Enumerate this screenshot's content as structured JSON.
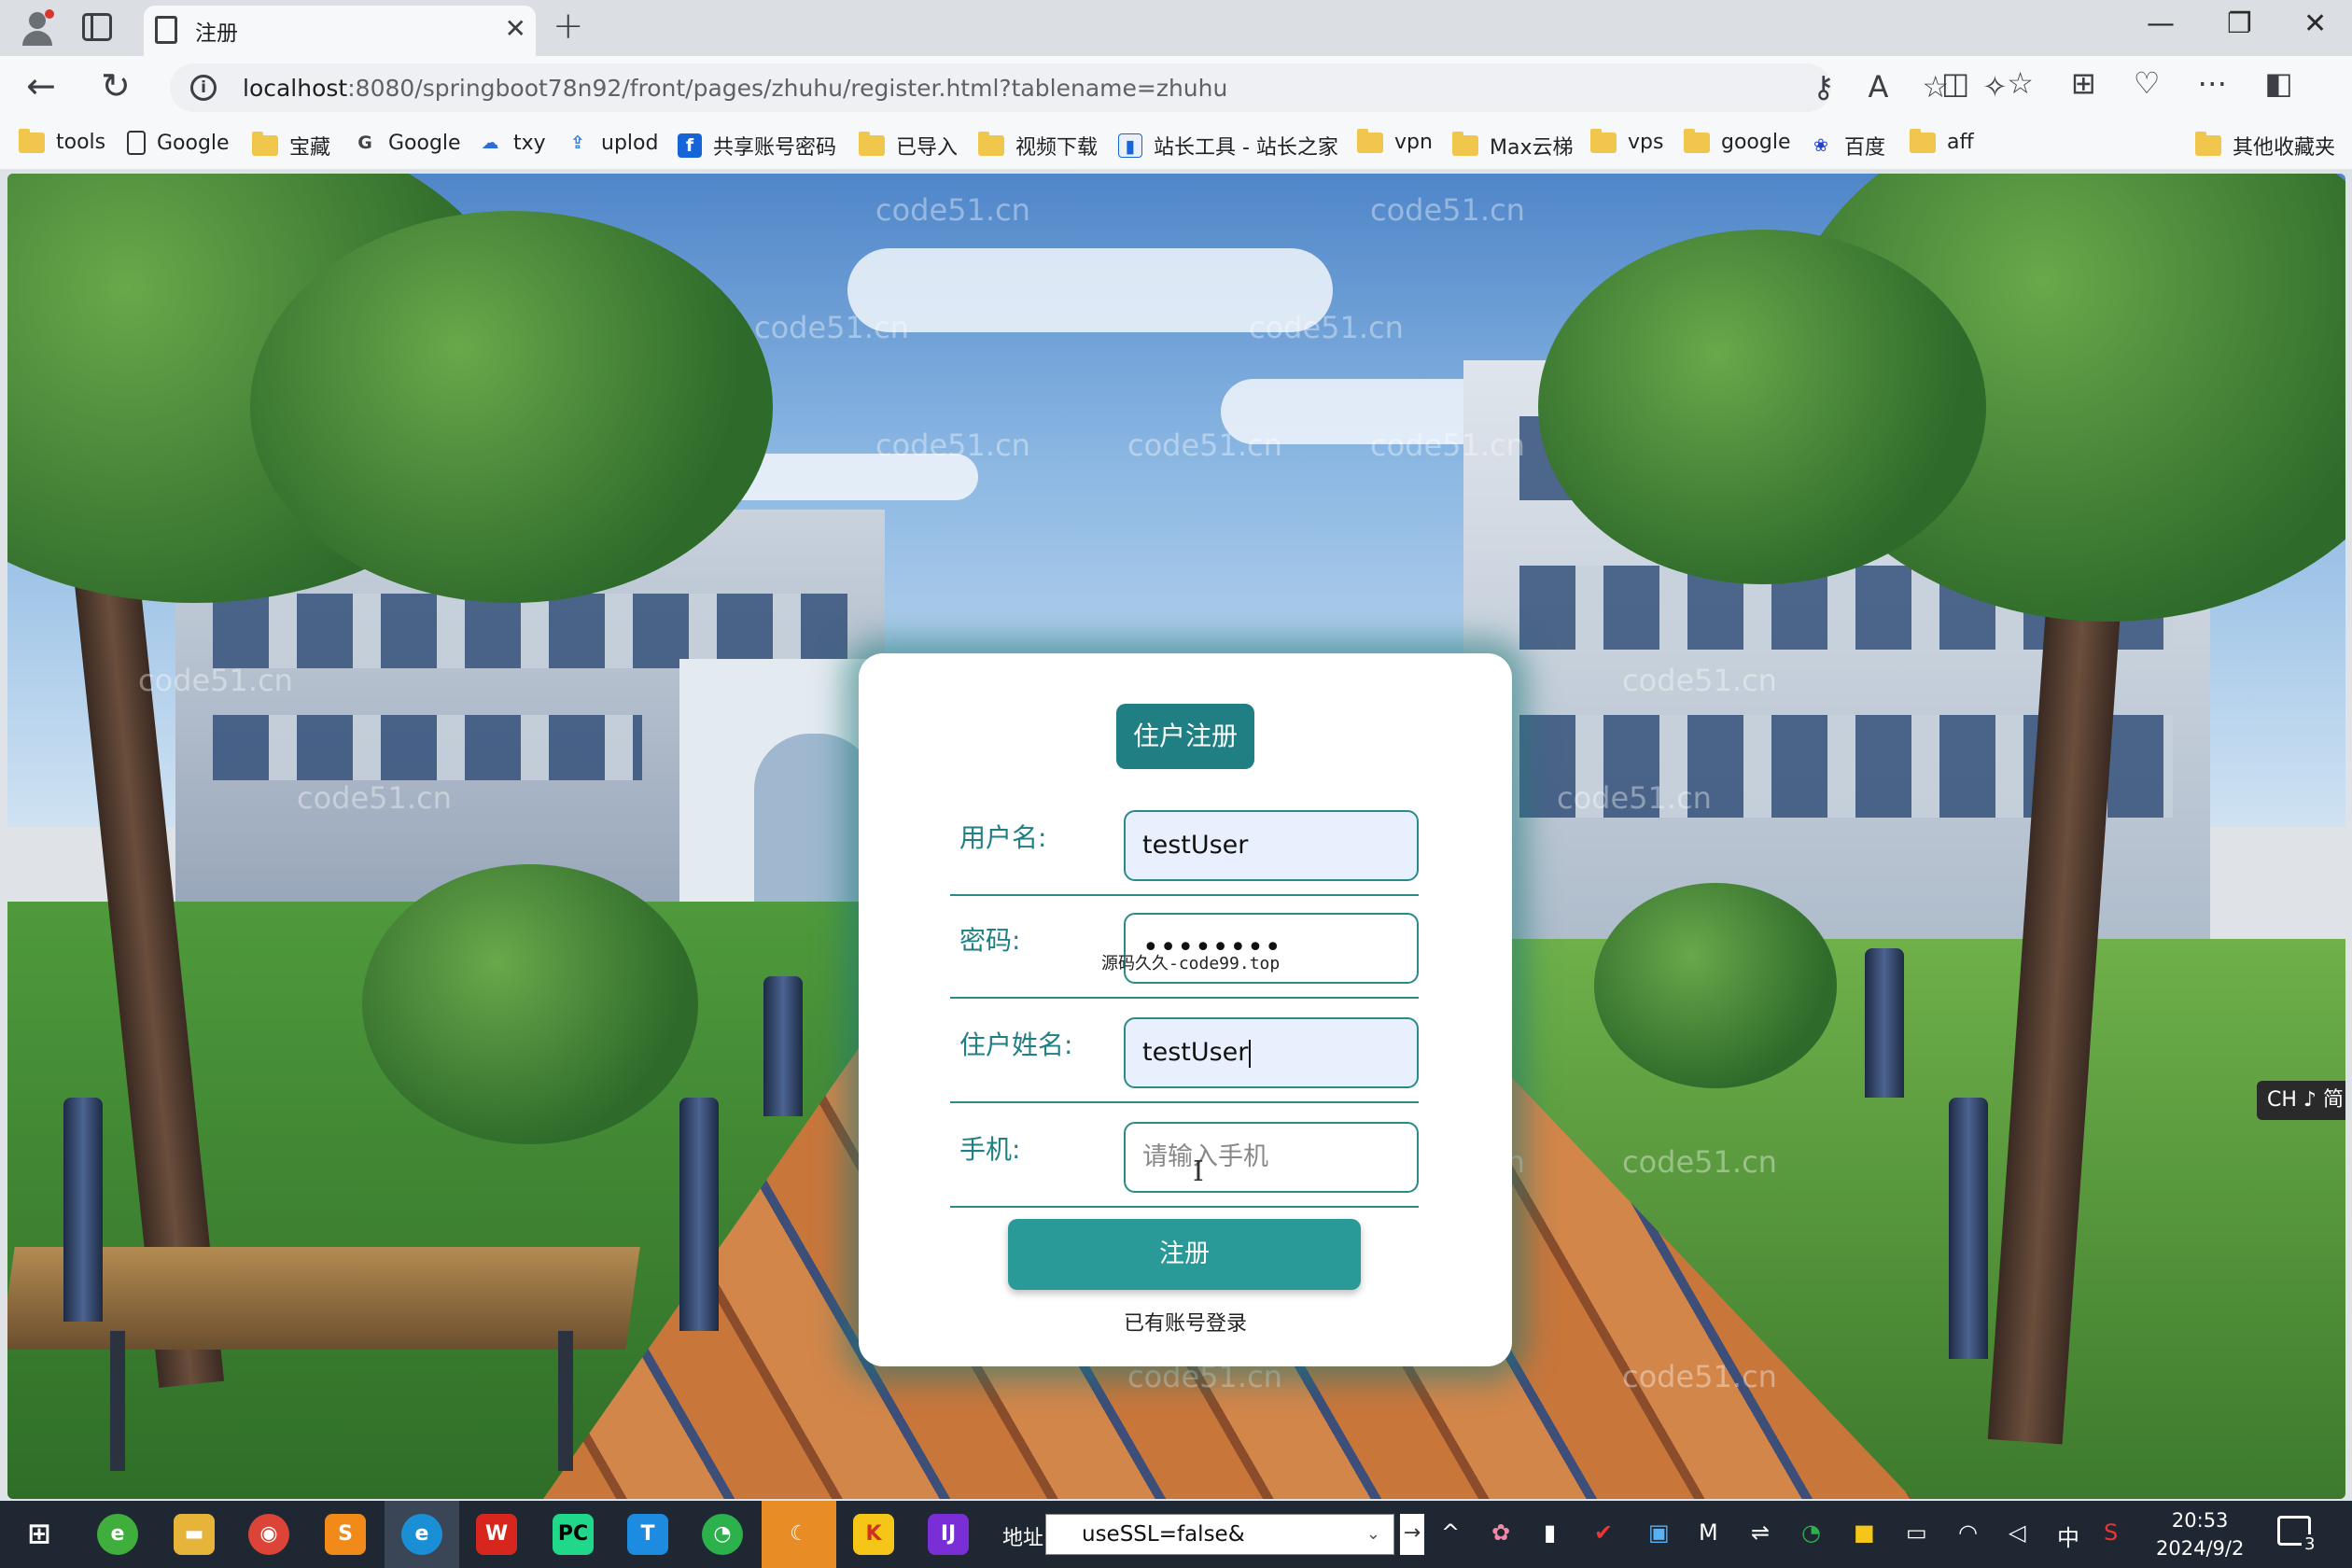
{
  "browser": {
    "tab_title": "注册",
    "url_host": "localhost",
    "url_rest": ":8080/springboot78n92/front/pages/zhuhu/register.html?tablename=zhuhu",
    "bookmarks": [
      {
        "label": "tools",
        "icon": "folder-icon"
      },
      {
        "label": "Google",
        "icon": "page-icon"
      },
      {
        "label": "宝藏",
        "icon": "folder-icon"
      },
      {
        "label": "Google",
        "icon": "google-icon"
      },
      {
        "label": "txy",
        "icon": "cloud-icon"
      },
      {
        "label": "uplod",
        "icon": "upload-icon"
      },
      {
        "label": "共享账号密码",
        "icon": "share-icon"
      },
      {
        "label": "已导入",
        "icon": "folder-icon"
      },
      {
        "label": "视频下载",
        "icon": "folder-icon"
      },
      {
        "label": "站长工具 - 站长之家",
        "icon": "chart-icon"
      },
      {
        "label": "vpn",
        "icon": "folder-icon"
      },
      {
        "label": "Max云梯",
        "icon": "folder-icon"
      },
      {
        "label": "vps",
        "icon": "folder-icon"
      },
      {
        "label": "google",
        "icon": "folder-icon"
      },
      {
        "label": "百度",
        "icon": "baidu-icon"
      },
      {
        "label": "aff",
        "icon": "folder-icon"
      }
    ],
    "other_bookmarks": "其他收藏夹"
  },
  "form": {
    "title": "住户注册",
    "username_label": "用户名:",
    "username_value": "testUser",
    "password_label": "密码:",
    "password_value": "••••••••",
    "password_note": "源码久久-code99.top",
    "name_label": "住户姓名:",
    "name_value": "testUser",
    "phone_label": "手机:",
    "phone_placeholder": "请输入手机",
    "submit_label": "注册",
    "login_link": "已有账号登录"
  },
  "watermark": "code51.cn",
  "ime_indicator": "CH ♪ 简",
  "taskbar": {
    "address_label": "地址",
    "address_value": "useSSL=false&",
    "input_method": "中",
    "time": "20:53",
    "date": "2024/9/2",
    "notification_count": "3"
  },
  "colors": {
    "accent": "#1f7f82",
    "button": "#2a9a98",
    "input_fill": "#e8f0fe",
    "card_glow": "#1e7878"
  }
}
